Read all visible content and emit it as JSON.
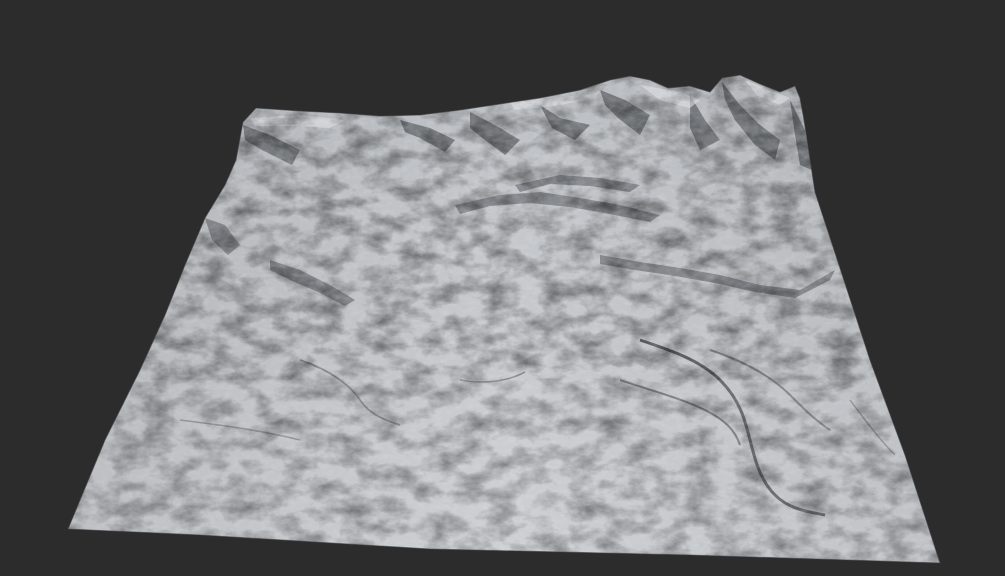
{
  "scene": {
    "subject": "terrain-heightmap-render",
    "colors": {
      "background": "#2c2c2c",
      "terrain_light": "#c9ccd0",
      "terrain_mid": "#a9adb2",
      "terrain_shadow": "#5a5e63",
      "terrain_deep_shadow": "#2f3236",
      "ridge_highlight": "#dfe1e4"
    }
  }
}
